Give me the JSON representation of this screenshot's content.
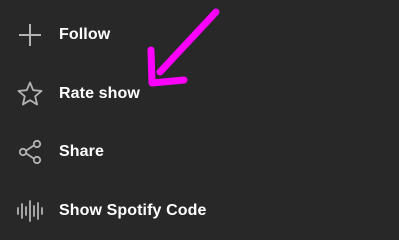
{
  "menu": {
    "items": [
      {
        "label": "Follow",
        "icon": "plus-icon"
      },
      {
        "label": "Rate show",
        "icon": "star-icon"
      },
      {
        "label": "Share",
        "icon": "share-icon"
      },
      {
        "label": "Show Spotify Code",
        "icon": "spotify-code-icon"
      }
    ]
  },
  "colors": {
    "background": "#282828",
    "text": "#ffffff",
    "icon": "#b3b3b3",
    "annotation": "#ff00ff"
  }
}
